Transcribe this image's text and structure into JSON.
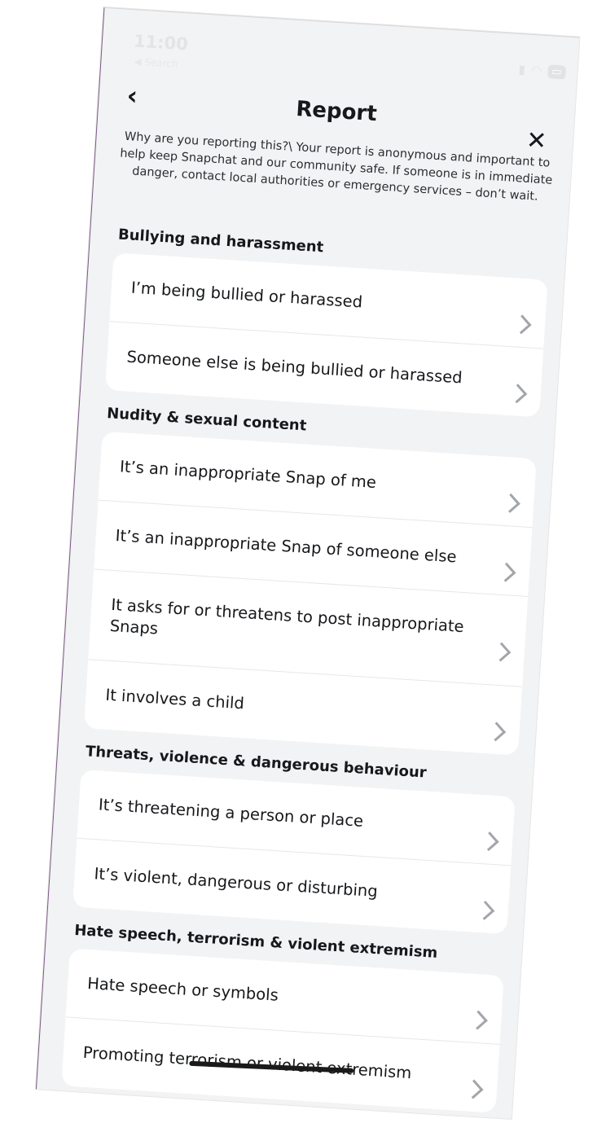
{
  "status_bar": {
    "time": "11:00",
    "back_app": "◀ Search"
  },
  "header": {
    "back_icon": "chevron-left-icon",
    "title": "Report",
    "close_icon": "close-icon",
    "subtitle": "Why are you reporting this?\\ Your report is anonymous and important to help keep Snapchat and our community safe. If someone is in immediate danger, contact local authorities or emergency services – don’t wait."
  },
  "sections": [
    {
      "title": "Bullying and harassment",
      "items": [
        "I’m being bullied or harassed",
        "Someone else is being bullied or harassed"
      ]
    },
    {
      "title": "Nudity & sexual content",
      "items": [
        "It’s an inappropriate Snap of me",
        "It’s an inappropriate Snap of someone else",
        "It asks for or threatens to post inappropriate Snaps",
        "It involves a child"
      ]
    },
    {
      "title": "Threats, violence & dangerous behaviour",
      "items": [
        "It’s threatening a person or place",
        "It’s violent, dangerous or disturbing"
      ]
    },
    {
      "title": "Hate speech, terrorism & violent extremism",
      "items": [
        "Hate speech or symbols",
        "Promoting terrorism or violent extremism"
      ]
    }
  ],
  "last_item_parts": {
    "prefix": "Promoting ter",
    "struck": "rorism or violent ext",
    "suffix": "remism"
  },
  "colors": {
    "background": "#f2f3f4",
    "card": "#ffffff",
    "text": "#16181b",
    "chevron": "#a2a5aa"
  }
}
